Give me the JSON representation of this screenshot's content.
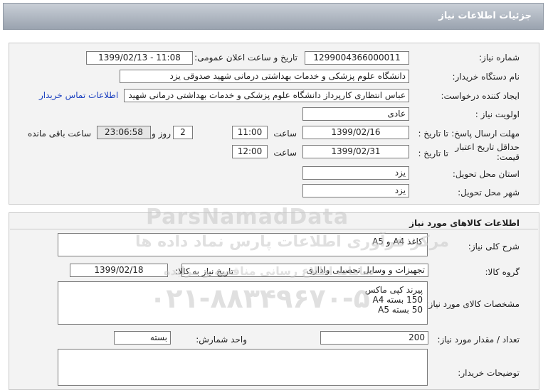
{
  "header": {
    "title": "جزئیات اطلاعات نیاز"
  },
  "need": {
    "number_label": "شماره نیاز:",
    "number": "1299004366000011",
    "announce_label": "تاریخ و ساعت اعلان عمومی:",
    "announce": "1399/02/13 - 11:08",
    "buyer_label": "نام دستگاه خریدار:",
    "buyer": "دانشگاه علوم پزشکی و خدمات بهداشتی درمانی شهید صدوقی یزد",
    "creator_label": "ایجاد کننده درخواست:",
    "creator": "عباس انتظاری کارپرداز دانشگاه علوم پزشکی و خدمات بهداشتی درمانی شهید",
    "contact_link": "اطلاعات تماس خریدار",
    "priority_label": "اولویت نیاز :",
    "priority": "عادی",
    "deadline_label": "مهلت ارسال پاسخ:",
    "to_date_label": "تا تاریخ :",
    "deadline_date": "1399/02/16",
    "time_label": "ساعت",
    "deadline_time": "11:00",
    "days": "2",
    "days_label": "روز و",
    "remaining": "23:06:58",
    "remaining_label": "ساعت باقی مانده",
    "validity_label": "حداقل تاریخ اعتبار قیمت:",
    "validity_date": "1399/02/31",
    "validity_time": "12:00",
    "province_label": "استان محل تحویل:",
    "province": "یزد",
    "city_label": "شهر محل تحویل:",
    "city": "یزد"
  },
  "goods": {
    "section_title": "اطلاعات کالاهای مورد نیاز",
    "desc_label": "شرح کلی نیاز:",
    "desc": "کاغذ A4 و A5",
    "group_label": "گروه کالا:",
    "group": "تجهیزات و وسایل تحصیلی واداری",
    "need_date_label": "تاریخ نیاز به کالا:",
    "need_date": "1399/02/18",
    "spec_label": "مشخصات کالای مورد نیاز:",
    "spec_lines": [
      "پیرند کپی ماکس",
      "150 بسته A4",
      "50 بسته A5"
    ],
    "qty_label": "تعداد / مقدار مورد نیاز:",
    "qty": "200",
    "unit_label": "واحد شمارش:",
    "unit": "بسته",
    "buyer_notes_label": "توضیحات خریدار:"
  },
  "watermark": {
    "brand": "ParsNamadData",
    "tagline": "مرکز فرآوری اطلاعات پارس نماد داده ها",
    "tagline2": "سامانه اطلاع رسانی مناقصه و مزایده",
    "phone": "۰۲۱-۸۸۳۴۹۶۷۰-۵"
  }
}
